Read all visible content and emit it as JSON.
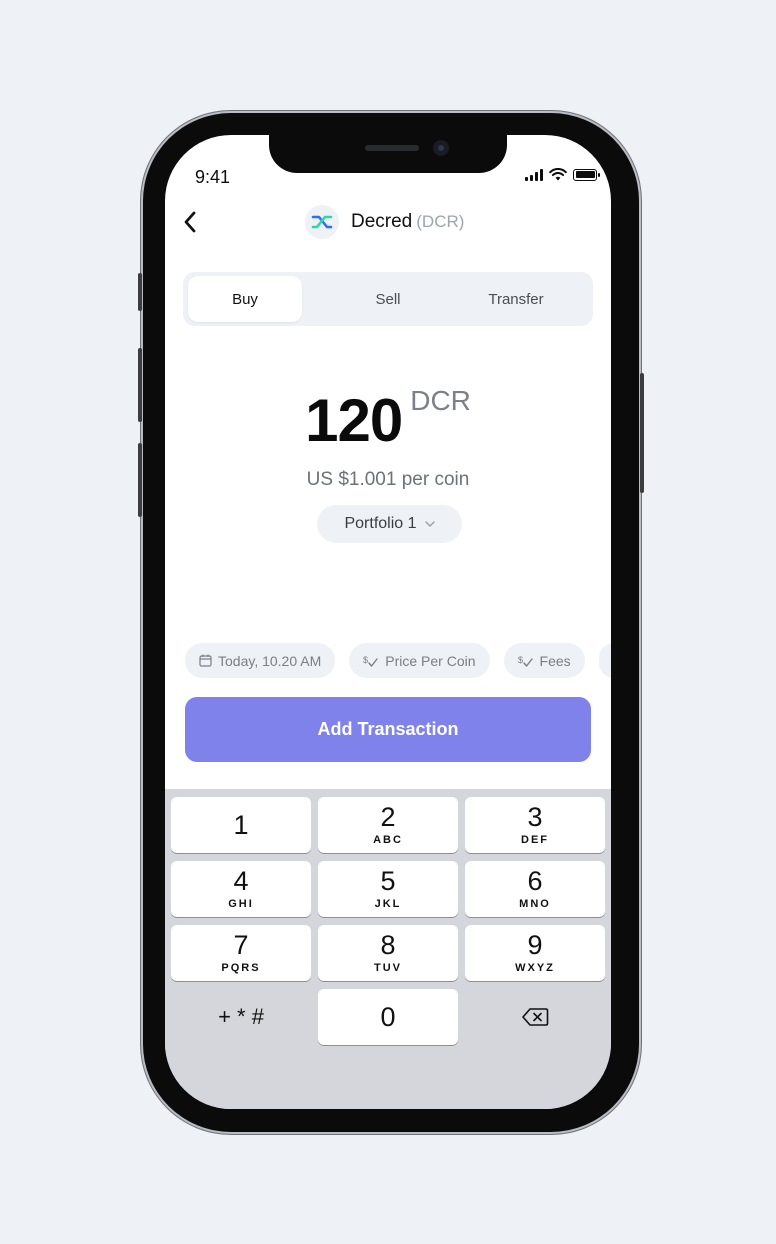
{
  "status_bar": {
    "time": "9:41"
  },
  "header": {
    "coin_name": "Decred",
    "coin_symbol": "(DCR)"
  },
  "tabs": [
    {
      "label": "Buy",
      "active": true
    },
    {
      "label": "Sell",
      "active": false
    },
    {
      "label": "Transfer",
      "active": false
    }
  ],
  "amount": {
    "value": "120",
    "unit": "DCR"
  },
  "price_line": "US $1.001 per coin",
  "portfolio": {
    "label": "Portfolio 1"
  },
  "chips": [
    {
      "label": "Today, 10.20 AM",
      "icon": "calendar-icon"
    },
    {
      "label": "Price Per Coin",
      "icon": "dollar-check-icon"
    },
    {
      "label": "Fees",
      "icon": "dollar-check-icon"
    }
  ],
  "add_button": "Add Transaction",
  "keypad": {
    "keys": [
      {
        "digit": "1",
        "letters": ""
      },
      {
        "digit": "2",
        "letters": "ABC"
      },
      {
        "digit": "3",
        "letters": "DEF"
      },
      {
        "digit": "4",
        "letters": "GHI"
      },
      {
        "digit": "5",
        "letters": "JKL"
      },
      {
        "digit": "6",
        "letters": "MNO"
      },
      {
        "digit": "7",
        "letters": "PQRS"
      },
      {
        "digit": "8",
        "letters": "TUV"
      },
      {
        "digit": "9",
        "letters": "WXYZ"
      }
    ],
    "symbols": "+ * #",
    "zero": "0"
  },
  "colors": {
    "accent": "#7f82ea",
    "keypad_bg": "#d4d6db",
    "chip_bg": "#eef1f5",
    "page_bg": "#eef2f6"
  }
}
